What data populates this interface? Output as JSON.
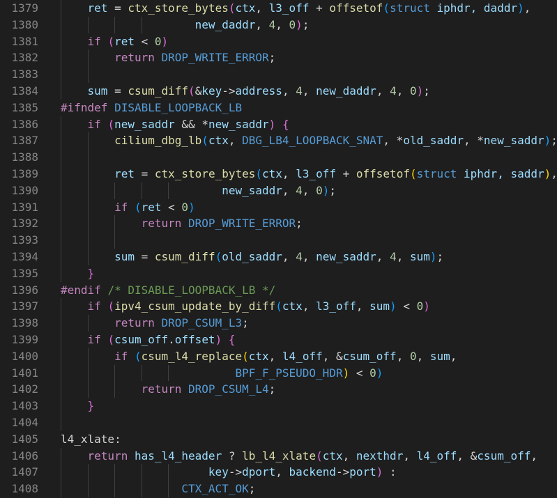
{
  "theme": {
    "background": "#1e1e1e",
    "line_number_color": "#858585",
    "indent_guide_color": "#404040",
    "token_colors": {
      "kw": "#569cd6",
      "ctl": "#c586c0",
      "fn": "#dcdcaa",
      "var": "#9cdcfe",
      "num": "#b5cea8",
      "mac": "#569cd6",
      "cmt": "#6a9955",
      "pp": "#c586c0",
      "pl": "#d4d4d4",
      "b1": "#ffd700",
      "b2": "#da70d6",
      "b3": "#179fff"
    }
  },
  "lines": [
    {
      "num": "1379",
      "guides": 1,
      "tokens": [
        [
          "    ",
          "pl"
        ],
        [
          "ret",
          "var"
        ],
        [
          " = ",
          "pl"
        ],
        [
          "ctx_store_bytes",
          "fn"
        ],
        [
          "(",
          "b2"
        ],
        [
          "ctx",
          "var"
        ],
        [
          ", ",
          "pl"
        ],
        [
          "l3_off",
          "var"
        ],
        [
          " + ",
          "pl"
        ],
        [
          "offsetof",
          "fn"
        ],
        [
          "(",
          "b3"
        ],
        [
          "struct",
          "kw"
        ],
        [
          " iphdr, daddr",
          "var"
        ],
        [
          ")",
          "b3"
        ],
        [
          ",",
          "pl"
        ]
      ]
    },
    {
      "num": "1380",
      "guides": 4,
      "tokens": [
        [
          "                    ",
          "pl"
        ],
        [
          "new_daddr",
          "var"
        ],
        [
          ", ",
          "pl"
        ],
        [
          "4",
          "num"
        ],
        [
          ", ",
          "pl"
        ],
        [
          "0",
          "num"
        ],
        [
          ")",
          "b2"
        ],
        [
          ";",
          "pl"
        ]
      ]
    },
    {
      "num": "1381",
      "guides": 1,
      "tokens": [
        [
          "    ",
          "pl"
        ],
        [
          "if",
          "ctl"
        ],
        [
          " ",
          "pl"
        ],
        [
          "(",
          "b2"
        ],
        [
          "ret",
          "var"
        ],
        [
          " < ",
          "pl"
        ],
        [
          "0",
          "num"
        ],
        [
          ")",
          "b2"
        ]
      ]
    },
    {
      "num": "1382",
      "guides": 2,
      "tokens": [
        [
          "        ",
          "pl"
        ],
        [
          "return",
          "ctl"
        ],
        [
          " ",
          "pl"
        ],
        [
          "DROP_WRITE_ERROR",
          "mac"
        ],
        [
          ";",
          "pl"
        ]
      ]
    },
    {
      "num": "1383",
      "guides": 2,
      "tokens": []
    },
    {
      "num": "1384",
      "guides": 1,
      "tokens": [
        [
          "    ",
          "pl"
        ],
        [
          "sum",
          "var"
        ],
        [
          " = ",
          "pl"
        ],
        [
          "csum_diff",
          "fn"
        ],
        [
          "(",
          "b2"
        ],
        [
          "&",
          "pl"
        ],
        [
          "key",
          "var"
        ],
        [
          "->",
          "pl"
        ],
        [
          "address",
          "var"
        ],
        [
          ", ",
          "pl"
        ],
        [
          "4",
          "num"
        ],
        [
          ", ",
          "pl"
        ],
        [
          "new_daddr",
          "var"
        ],
        [
          ", ",
          "pl"
        ],
        [
          "4",
          "num"
        ],
        [
          ", ",
          "pl"
        ],
        [
          "0",
          "num"
        ],
        [
          ")",
          "b2"
        ],
        [
          ";",
          "pl"
        ]
      ]
    },
    {
      "num": "1385",
      "guides": 0,
      "tokens": [
        [
          "#ifndef",
          "pp"
        ],
        [
          " ",
          "pl"
        ],
        [
          "DISABLE_LOOPBACK_LB",
          "mac"
        ]
      ]
    },
    {
      "num": "1386",
      "guides": 1,
      "tokens": [
        [
          "    ",
          "pl"
        ],
        [
          "if",
          "ctl"
        ],
        [
          " ",
          "pl"
        ],
        [
          "(",
          "b2"
        ],
        [
          "new_saddr",
          "var"
        ],
        [
          " && ",
          "pl"
        ],
        [
          "*",
          "pl"
        ],
        [
          "new_saddr",
          "var"
        ],
        [
          ")",
          "b2"
        ],
        [
          " ",
          "pl"
        ],
        [
          "{",
          "b2"
        ]
      ]
    },
    {
      "num": "1387",
      "guides": 2,
      "tokens": [
        [
          "        ",
          "pl"
        ],
        [
          "cilium_dbg_lb",
          "fn"
        ],
        [
          "(",
          "b3"
        ],
        [
          "ctx",
          "var"
        ],
        [
          ", ",
          "pl"
        ],
        [
          "DBG_LB4_LOOPBACK_SNAT",
          "mac"
        ],
        [
          ", ",
          "pl"
        ],
        [
          "*",
          "pl"
        ],
        [
          "old_saddr",
          "var"
        ],
        [
          ", ",
          "pl"
        ],
        [
          "*",
          "pl"
        ],
        [
          "new_saddr",
          "var"
        ],
        [
          ")",
          "b3"
        ],
        [
          ";",
          "pl"
        ]
      ]
    },
    {
      "num": "1388",
      "guides": 2,
      "tokens": []
    },
    {
      "num": "1389",
      "guides": 2,
      "tokens": [
        [
          "        ",
          "pl"
        ],
        [
          "ret",
          "var"
        ],
        [
          " = ",
          "pl"
        ],
        [
          "ctx_store_bytes",
          "fn"
        ],
        [
          "(",
          "b3"
        ],
        [
          "ctx",
          "var"
        ],
        [
          ", ",
          "pl"
        ],
        [
          "l3_off",
          "var"
        ],
        [
          " + ",
          "pl"
        ],
        [
          "offsetof",
          "fn"
        ],
        [
          "(",
          "b1"
        ],
        [
          "struct",
          "kw"
        ],
        [
          " iphdr, saddr",
          "var"
        ],
        [
          ")",
          "b1"
        ],
        [
          ",",
          "pl"
        ]
      ]
    },
    {
      "num": "1390",
      "guides": 5,
      "tokens": [
        [
          "                        ",
          "pl"
        ],
        [
          "new_saddr",
          "var"
        ],
        [
          ", ",
          "pl"
        ],
        [
          "4",
          "num"
        ],
        [
          ", ",
          "pl"
        ],
        [
          "0",
          "num"
        ],
        [
          ")",
          "b3"
        ],
        [
          ";",
          "pl"
        ]
      ]
    },
    {
      "num": "1391",
      "guides": 2,
      "tokens": [
        [
          "        ",
          "pl"
        ],
        [
          "if",
          "ctl"
        ],
        [
          " ",
          "pl"
        ],
        [
          "(",
          "b3"
        ],
        [
          "ret",
          "var"
        ],
        [
          " < ",
          "pl"
        ],
        [
          "0",
          "num"
        ],
        [
          ")",
          "b3"
        ]
      ]
    },
    {
      "num": "1392",
      "guides": 3,
      "tokens": [
        [
          "            ",
          "pl"
        ],
        [
          "return",
          "ctl"
        ],
        [
          " ",
          "pl"
        ],
        [
          "DROP_WRITE_ERROR",
          "mac"
        ],
        [
          ";",
          "pl"
        ]
      ]
    },
    {
      "num": "1393",
      "guides": 3,
      "tokens": []
    },
    {
      "num": "1394",
      "guides": 2,
      "tokens": [
        [
          "        ",
          "pl"
        ],
        [
          "sum",
          "var"
        ],
        [
          " = ",
          "pl"
        ],
        [
          "csum_diff",
          "fn"
        ],
        [
          "(",
          "b3"
        ],
        [
          "old_saddr",
          "var"
        ],
        [
          ", ",
          "pl"
        ],
        [
          "4",
          "num"
        ],
        [
          ", ",
          "pl"
        ],
        [
          "new_saddr",
          "var"
        ],
        [
          ", ",
          "pl"
        ],
        [
          "4",
          "num"
        ],
        [
          ", ",
          "pl"
        ],
        [
          "sum",
          "var"
        ],
        [
          ")",
          "b3"
        ],
        [
          ";",
          "pl"
        ]
      ]
    },
    {
      "num": "1395",
      "guides": 1,
      "tokens": [
        [
          "    ",
          "pl"
        ],
        [
          "}",
          "b2"
        ]
      ]
    },
    {
      "num": "1396",
      "guides": 0,
      "tokens": [
        [
          "#endif",
          "pp"
        ],
        [
          " ",
          "pl"
        ],
        [
          "/* DISABLE_LOOPBACK_LB */",
          "cmt"
        ]
      ]
    },
    {
      "num": "1397",
      "guides": 1,
      "tokens": [
        [
          "    ",
          "pl"
        ],
        [
          "if",
          "ctl"
        ],
        [
          " ",
          "pl"
        ],
        [
          "(",
          "b2"
        ],
        [
          "ipv4_csum_update_by_diff",
          "fn"
        ],
        [
          "(",
          "b3"
        ],
        [
          "ctx",
          "var"
        ],
        [
          ", ",
          "pl"
        ],
        [
          "l3_off",
          "var"
        ],
        [
          ", ",
          "pl"
        ],
        [
          "sum",
          "var"
        ],
        [
          ")",
          "b3"
        ],
        [
          " < ",
          "pl"
        ],
        [
          "0",
          "num"
        ],
        [
          ")",
          "b2"
        ]
      ]
    },
    {
      "num": "1398",
      "guides": 2,
      "tokens": [
        [
          "        ",
          "pl"
        ],
        [
          "return",
          "ctl"
        ],
        [
          " ",
          "pl"
        ],
        [
          "DROP_CSUM_L3",
          "mac"
        ],
        [
          ";",
          "pl"
        ]
      ]
    },
    {
      "num": "1399",
      "guides": 1,
      "tokens": [
        [
          "    ",
          "pl"
        ],
        [
          "if",
          "ctl"
        ],
        [
          " ",
          "pl"
        ],
        [
          "(",
          "b2"
        ],
        [
          "csum_off",
          "var"
        ],
        [
          ".",
          "pl"
        ],
        [
          "offset",
          "var"
        ],
        [
          ")",
          "b2"
        ],
        [
          " ",
          "pl"
        ],
        [
          "{",
          "b2"
        ]
      ]
    },
    {
      "num": "1400",
      "guides": 2,
      "tokens": [
        [
          "        ",
          "pl"
        ],
        [
          "if",
          "ctl"
        ],
        [
          " ",
          "pl"
        ],
        [
          "(",
          "b3"
        ],
        [
          "csum_l4_replace",
          "fn"
        ],
        [
          "(",
          "b1"
        ],
        [
          "ctx",
          "var"
        ],
        [
          ", ",
          "pl"
        ],
        [
          "l4_off",
          "var"
        ],
        [
          ", ",
          "pl"
        ],
        [
          "&",
          "pl"
        ],
        [
          "csum_off",
          "var"
        ],
        [
          ", ",
          "pl"
        ],
        [
          "0",
          "num"
        ],
        [
          ", ",
          "pl"
        ],
        [
          "sum",
          "var"
        ],
        [
          ",",
          "pl"
        ]
      ]
    },
    {
      "num": "1401",
      "guides": 5,
      "tokens": [
        [
          "                          ",
          "pl"
        ],
        [
          "BPF_F_PSEUDO_HDR",
          "mac"
        ],
        [
          ")",
          "b1"
        ],
        [
          " < ",
          "pl"
        ],
        [
          "0",
          "num"
        ],
        [
          ")",
          "b3"
        ]
      ]
    },
    {
      "num": "1402",
      "guides": 3,
      "tokens": [
        [
          "            ",
          "pl"
        ],
        [
          "return",
          "ctl"
        ],
        [
          " ",
          "pl"
        ],
        [
          "DROP_CSUM_L4",
          "mac"
        ],
        [
          ";",
          "pl"
        ]
      ]
    },
    {
      "num": "1403",
      "guides": 1,
      "tokens": [
        [
          "    ",
          "pl"
        ],
        [
          "}",
          "b2"
        ]
      ]
    },
    {
      "num": "1404",
      "guides": 1,
      "tokens": []
    },
    {
      "num": "1405",
      "guides": 0,
      "tokens": [
        [
          "l4_xlate",
          "pl"
        ],
        [
          ":",
          "pl"
        ]
      ]
    },
    {
      "num": "1406",
      "guides": 1,
      "tokens": [
        [
          "    ",
          "pl"
        ],
        [
          "return",
          "ctl"
        ],
        [
          " ",
          "pl"
        ],
        [
          "has_l4_header",
          "var"
        ],
        [
          " ? ",
          "pl"
        ],
        [
          "lb_l4_xlate",
          "fn"
        ],
        [
          "(",
          "b2"
        ],
        [
          "ctx",
          "var"
        ],
        [
          ", ",
          "pl"
        ],
        [
          "nexthdr",
          "var"
        ],
        [
          ", ",
          "pl"
        ],
        [
          "l4_off",
          "var"
        ],
        [
          ", ",
          "pl"
        ],
        [
          "&",
          "pl"
        ],
        [
          "csum_off",
          "var"
        ],
        [
          ",",
          "pl"
        ]
      ]
    },
    {
      "num": "1407",
      "guides": 5,
      "tokens": [
        [
          "                      ",
          "pl"
        ],
        [
          "key",
          "var"
        ],
        [
          "->",
          "pl"
        ],
        [
          "dport",
          "var"
        ],
        [
          ", ",
          "pl"
        ],
        [
          "backend",
          "var"
        ],
        [
          "->",
          "pl"
        ],
        [
          "port",
          "var"
        ],
        [
          ")",
          "b2"
        ],
        [
          " :",
          "pl"
        ]
      ]
    },
    {
      "num": "1408",
      "guides": 5,
      "tokens": [
        [
          "                  ",
          "pl"
        ],
        [
          "CTX_ACT_OK",
          "mac"
        ],
        [
          ";",
          "pl"
        ]
      ]
    }
  ]
}
